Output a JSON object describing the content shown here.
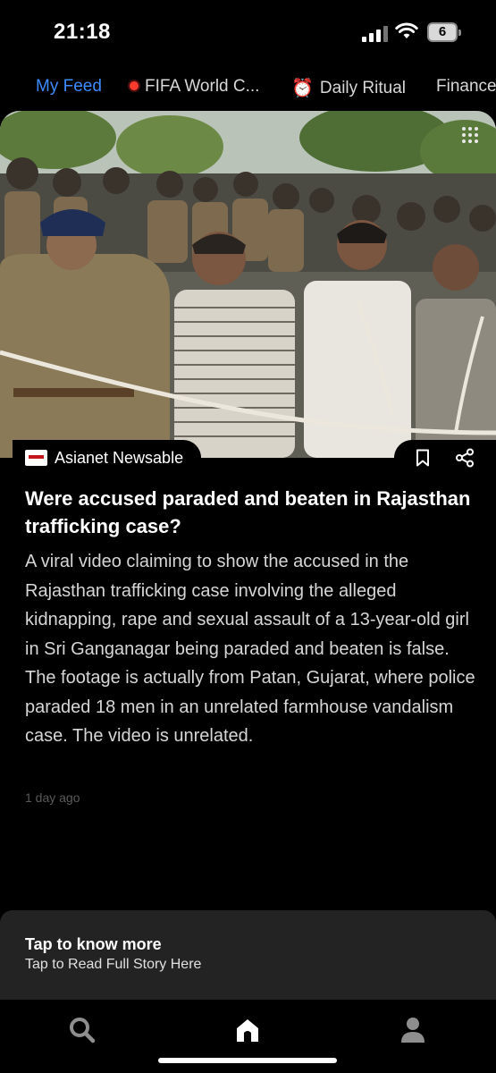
{
  "status_bar": {
    "time": "21:18",
    "battery": "6"
  },
  "tabs": [
    {
      "label": "My Feed",
      "active": true
    },
    {
      "label": "FIFA World C...",
      "icon": "live-dot-icon"
    },
    {
      "label": "Daily Ritual",
      "icon": "alarm-clock-icon"
    },
    {
      "label": "Finance"
    }
  ],
  "article": {
    "source": "Asianet Newsable",
    "headline": "Were accused paraded and beaten in Rajasthan trafficking case?",
    "summary": "A viral video claiming to show the accused in the Rajasthan trafficking case involving the alleged kidnapping, rape and sexual assault of a 13-year-old girl in Sri Ganganagar being paraded and beaten is false. The footage is actually from Patan, Gujarat, where police paraded 18 men in an unrelated farmhouse vandalism case. The video is unrelated.",
    "age": "1 day ago"
  },
  "banner": {
    "title": "Tap to know more",
    "subtitle": "Tap to Read Full Story Here"
  },
  "nav": [
    "search-icon",
    "home-icon",
    "profile-icon"
  ],
  "colors": {
    "accent": "#3d8bff",
    "background": "#000000",
    "banner_bg": "#232323",
    "live": "#ff3b30"
  }
}
